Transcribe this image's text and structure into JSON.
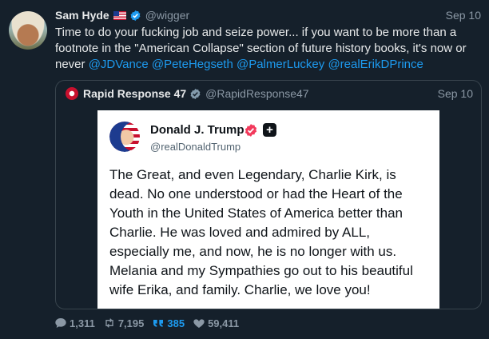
{
  "tweet": {
    "author_name": "Sam Hyde",
    "author_handle": "@wigger",
    "date": "Sep 10",
    "text_line1": "Time to do your fucking job and seize power... if you want to be more than",
    "text_line2": "a footnote in the \"American Collapse\" section of future history books, it's",
    "text_line3": "now or never ",
    "mentions": [
      "@JDVance",
      "@PeteHegseth",
      "@PalmerLuckey",
      "@realErikDPrince"
    ]
  },
  "quoted": {
    "author_name": "Rapid Response 47",
    "author_handle": "@RapidResponse47",
    "date": "Sep 10",
    "card": {
      "name": "Donald J. Trump",
      "handle": "@realDonaldTrump",
      "plus_symbol": "+",
      "text": "The Great, and even Legendary, Charlie Kirk, is dead. No one understood or had the Heart of the Youth in the United States of America better than Charlie. He was loved and admired by ALL, especially me, and now, he is no longer with us. Melania and my Sympathies go out to his beautiful wife Erika, and family. Charlie, we love you!"
    }
  },
  "stats": {
    "replies": "1,311",
    "retweets": "7,195",
    "quotes": "385",
    "likes": "59,411"
  },
  "icons": {
    "flag": "us-flag-icon",
    "verified": "verified-icon",
    "gray_verified": "gray-verified-icon",
    "reply": "reply-icon",
    "retweet": "retweet-icon",
    "quote": "quote-icon",
    "like": "heart-icon"
  },
  "colors": {
    "background": "#15202b",
    "accent": "#1d9bf0",
    "muted": "#8b98a5",
    "border": "#38444d",
    "card": "#ffffff",
    "truth_badge": "#f23a5c"
  }
}
